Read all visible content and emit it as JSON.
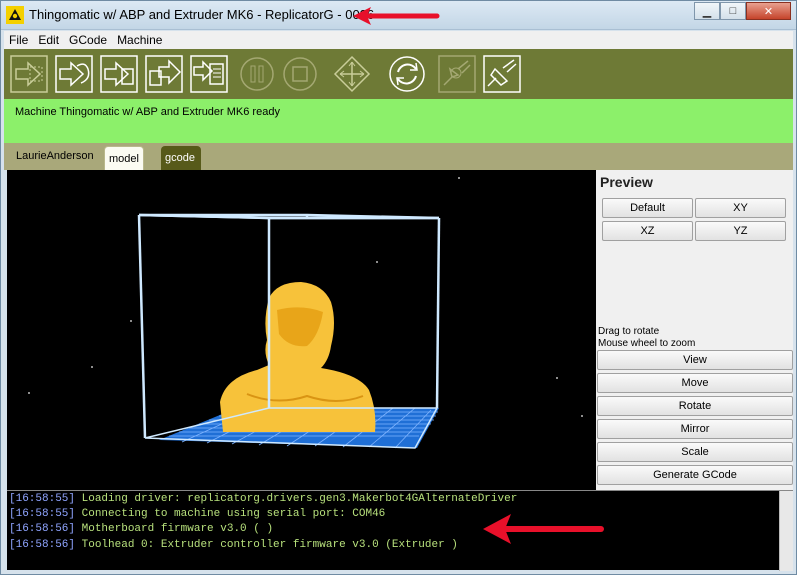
{
  "window": {
    "title": "Thingomatic w/ ABP and Extruder MK6 - ReplicatorG - 0026",
    "minimize_label": "▁",
    "maximize_label": "□",
    "close_label": "✕"
  },
  "menu": [
    "File",
    "Edit",
    "GCode",
    "Machine"
  ],
  "toolbar": {
    "icons": [
      "build-icon",
      "build-to-file-icon",
      "build-to-sd-icon",
      "playback-sd-icon",
      "upload-icon",
      "pause-icon",
      "stop-icon",
      "control-panel-icon",
      "reset-icon",
      "disconnect-icon",
      "connect-icon"
    ]
  },
  "status": {
    "text": "Machine Thingomatic w/ ABP and Extruder MK6 ready"
  },
  "tabs": {
    "file_label": "LaurieAnderson",
    "model": "model",
    "gcode": "gcode"
  },
  "preview": {
    "title": "Preview",
    "buttons": [
      "Default",
      "XY",
      "XZ",
      "YZ"
    ],
    "hint_rotate": "Drag to rotate",
    "hint_zoom": "Mouse wheel to zoom"
  },
  "actions": [
    "View",
    "Move",
    "Rotate",
    "Mirror",
    "Scale",
    "Generate GCode"
  ],
  "console": [
    {
      "time": "[16:58:55]",
      "message": "Loading driver: replicatorg.drivers.gen3.Makerbot4GAlternateDriver"
    },
    {
      "time": "[16:58:55]",
      "message": "Connecting to machine using serial port: COM46"
    },
    {
      "time": "[16:58:56]",
      "message": "Motherboard firmware v3.0 ( )"
    },
    {
      "time": "[16:58:56]",
      "message": "Toolhead 0: Extruder controller firmware v3.0 (Extruder )"
    }
  ],
  "colors": {
    "toolbar": "#6e7a36",
    "status": "#8cf06a",
    "annotation_arrow": "#e8102a",
    "build_platform": "#1f6fd6",
    "model": "#f7c23a"
  }
}
